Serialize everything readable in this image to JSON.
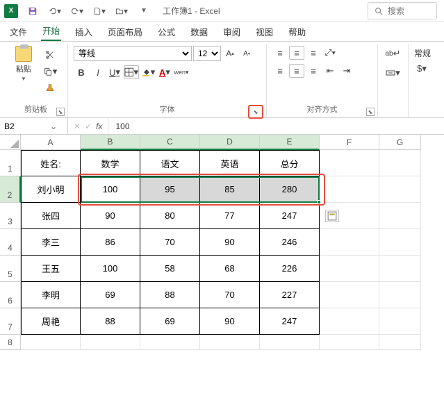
{
  "titlebar": {
    "workbook": "工作簿1",
    "app": "Excel",
    "separator": " - "
  },
  "search": {
    "placeholder": "搜索"
  },
  "tabs": {
    "file": "文件",
    "home": "开始",
    "insert": "插入",
    "page_layout": "页面布局",
    "formulas": "公式",
    "data": "数据",
    "review": "审阅",
    "view": "视图",
    "help": "帮助"
  },
  "ribbon": {
    "clipboard": {
      "paste": "粘贴",
      "group": "剪贴板"
    },
    "font": {
      "name": "等线",
      "size": "12",
      "group": "字体",
      "bold": "B",
      "italic": "I",
      "underline": "U",
      "wen": "wen"
    },
    "alignment": {
      "group": "对齐方式"
    },
    "number": {
      "general": "常规"
    },
    "wrap": "ab"
  },
  "namebox": {
    "ref": "B2"
  },
  "formula": {
    "value": "100"
  },
  "columns": [
    "A",
    "B",
    "C",
    "D",
    "E",
    "F",
    "G"
  ],
  "rows": [
    "1",
    "2",
    "3",
    "4",
    "5",
    "6",
    "7",
    "8"
  ],
  "table": {
    "headers": {
      "name": "姓名:",
      "c1": "数学",
      "c2": "语文",
      "c3": "英语",
      "c4": "总分"
    },
    "data": [
      {
        "name": "刘小明",
        "c1": "100",
        "c2": "95",
        "c3": "85",
        "c4": "280"
      },
      {
        "name": "张四",
        "c1": "90",
        "c2": "80",
        "c3": "77",
        "c4": "247"
      },
      {
        "name": "李三",
        "c1": "86",
        "c2": "70",
        "c3": "90",
        "c4": "246"
      },
      {
        "name": "王五",
        "c1": "100",
        "c2": "58",
        "c3": "68",
        "c4": "226"
      },
      {
        "name": "李明",
        "c1": "69",
        "c2": "88",
        "c3": "70",
        "c4": "227"
      },
      {
        "name": "周艳",
        "c1": "88",
        "c2": "69",
        "c3": "90",
        "c4": "247"
      }
    ]
  }
}
